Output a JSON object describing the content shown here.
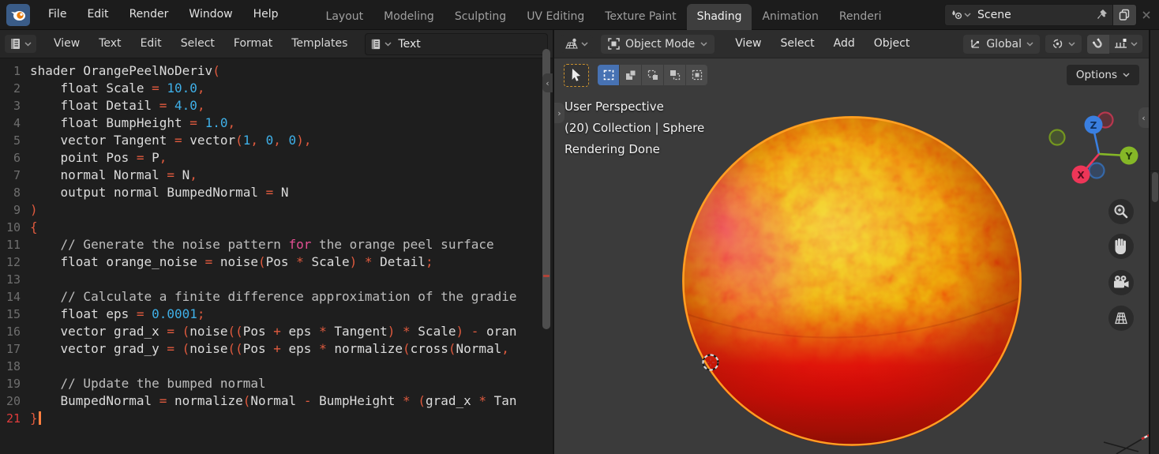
{
  "topbar": {
    "menus": [
      "File",
      "Edit",
      "Render",
      "Window",
      "Help"
    ],
    "workspace_tabs": [
      "Layout",
      "Modeling",
      "Sculpting",
      "UV Editing",
      "Texture Paint",
      "Shading",
      "Animation",
      "Renderi"
    ],
    "active_tab": "Shading",
    "scene": {
      "name": "Scene"
    }
  },
  "text_editor": {
    "menus": [
      "View",
      "Text",
      "Edit",
      "Select",
      "Format",
      "Templates"
    ],
    "datablock_name": "Text",
    "code": {
      "current_line": 21,
      "lines": [
        {
          "num": 1,
          "tokens": [
            [
              "plain",
              "shader OrangePeelNoDeriv"
            ],
            [
              "punct",
              "("
            ]
          ]
        },
        {
          "num": 2,
          "tokens": [
            [
              "plain",
              "    float Scale "
            ],
            [
              "punct",
              "= "
            ],
            [
              "num",
              "10.0"
            ],
            [
              "punct",
              ","
            ]
          ]
        },
        {
          "num": 3,
          "tokens": [
            [
              "plain",
              "    float Detail "
            ],
            [
              "punct",
              "= "
            ],
            [
              "num",
              "4.0"
            ],
            [
              "punct",
              ","
            ]
          ]
        },
        {
          "num": 4,
          "tokens": [
            [
              "plain",
              "    float BumpHeight "
            ],
            [
              "punct",
              "= "
            ],
            [
              "num",
              "1.0"
            ],
            [
              "punct",
              ","
            ]
          ]
        },
        {
          "num": 5,
          "tokens": [
            [
              "plain",
              "    vector Tangent "
            ],
            [
              "punct",
              "= "
            ],
            [
              "plain",
              "vector"
            ],
            [
              "punct",
              "("
            ],
            [
              "num",
              "1"
            ],
            [
              "punct",
              ", "
            ],
            [
              "num",
              "0"
            ],
            [
              "punct",
              ", "
            ],
            [
              "num",
              "0"
            ],
            [
              "punct",
              "),"
            ]
          ]
        },
        {
          "num": 6,
          "tokens": [
            [
              "plain",
              "    point Pos "
            ],
            [
              "punct",
              "= "
            ],
            [
              "plain",
              "P"
            ],
            [
              "punct",
              ","
            ]
          ]
        },
        {
          "num": 7,
          "tokens": [
            [
              "plain",
              "    normal Normal "
            ],
            [
              "punct",
              "= "
            ],
            [
              "plain",
              "N"
            ],
            [
              "punct",
              ","
            ]
          ]
        },
        {
          "num": 8,
          "tokens": [
            [
              "plain",
              "    output normal BumpedNormal "
            ],
            [
              "punct",
              "= "
            ],
            [
              "plain",
              "N"
            ]
          ]
        },
        {
          "num": 9,
          "tokens": [
            [
              "punct",
              ")"
            ]
          ]
        },
        {
          "num": 10,
          "tokens": [
            [
              "punct",
              "{"
            ]
          ]
        },
        {
          "num": 11,
          "tokens": [
            [
              "comment",
              "    // Generate the noise pattern "
            ],
            [
              "keyword",
              "for"
            ],
            [
              "comment",
              " the orange peel surface"
            ]
          ]
        },
        {
          "num": 12,
          "tokens": [
            [
              "plain",
              "    float orange_noise "
            ],
            [
              "punct",
              "= "
            ],
            [
              "plain",
              "noise"
            ],
            [
              "punct",
              "("
            ],
            [
              "plain",
              "Pos "
            ],
            [
              "punct",
              "* "
            ],
            [
              "plain",
              "Scale"
            ],
            [
              "punct",
              ") * "
            ],
            [
              "plain",
              "Detail"
            ],
            [
              "punct",
              ";"
            ]
          ]
        },
        {
          "num": 13,
          "tokens": []
        },
        {
          "num": 14,
          "tokens": [
            [
              "comment",
              "    // Calculate a finite difference approximation of the gradie"
            ]
          ]
        },
        {
          "num": 15,
          "tokens": [
            [
              "plain",
              "    float eps "
            ],
            [
              "punct",
              "= "
            ],
            [
              "num",
              "0.0001"
            ],
            [
              "punct",
              ";"
            ]
          ]
        },
        {
          "num": 16,
          "tokens": [
            [
              "plain",
              "    vector grad_x "
            ],
            [
              "punct",
              "= ("
            ],
            [
              "plain",
              "noise"
            ],
            [
              "punct",
              "(("
            ],
            [
              "plain",
              "Pos "
            ],
            [
              "punct",
              "+ "
            ],
            [
              "plain",
              "eps "
            ],
            [
              "punct",
              "* "
            ],
            [
              "plain",
              "Tangent"
            ],
            [
              "punct",
              ") * "
            ],
            [
              "plain",
              "Scale"
            ],
            [
              "punct",
              ") - "
            ],
            [
              "plain",
              "oran"
            ]
          ]
        },
        {
          "num": 17,
          "tokens": [
            [
              "plain",
              "    vector grad_y "
            ],
            [
              "punct",
              "= ("
            ],
            [
              "plain",
              "noise"
            ],
            [
              "punct",
              "(("
            ],
            [
              "plain",
              "Pos "
            ],
            [
              "punct",
              "+ "
            ],
            [
              "plain",
              "eps "
            ],
            [
              "punct",
              "* "
            ],
            [
              "plain",
              "normalize"
            ],
            [
              "punct",
              "("
            ],
            [
              "plain",
              "cross"
            ],
            [
              "punct",
              "("
            ],
            [
              "plain",
              "Normal"
            ],
            [
              "punct",
              ","
            ]
          ]
        },
        {
          "num": 18,
          "tokens": []
        },
        {
          "num": 19,
          "tokens": [
            [
              "comment",
              "    // Update the bumped normal"
            ]
          ]
        },
        {
          "num": 20,
          "tokens": [
            [
              "plain",
              "    BumpedNormal "
            ],
            [
              "punct",
              "= "
            ],
            [
              "plain",
              "normalize"
            ],
            [
              "punct",
              "("
            ],
            [
              "plain",
              "Normal "
            ],
            [
              "punct",
              "- "
            ],
            [
              "plain",
              "BumpHeight "
            ],
            [
              "punct",
              "* ("
            ],
            [
              "plain",
              "grad_x "
            ],
            [
              "punct",
              "* "
            ],
            [
              "plain",
              "Tan"
            ]
          ]
        },
        {
          "num": 21,
          "tokens": [
            [
              "punct",
              "}"
            ]
          ]
        }
      ]
    }
  },
  "viewport": {
    "mode": "Object Mode",
    "menus": [
      "View",
      "Select",
      "Add",
      "Object"
    ],
    "orientation": "Global",
    "options_label": "Options",
    "overlay_lines": [
      "User Perspective",
      "(20) Collection | Sphere",
      "Rendering Done"
    ],
    "gizmo_axes": {
      "x": "X",
      "y": "Y",
      "z": "Z"
    }
  },
  "colors": {
    "accent-blue": "#4772b3",
    "syntax-plain": "#dcdcdc",
    "syntax-punct": "#e05a3e",
    "syntax-num": "#3fb0e8",
    "syntax-keyword": "#e44f93",
    "syntax-comment": "#bdbdbd",
    "line-number": "#6e6e6e",
    "line-number-active": "#e23c3c",
    "cursor-orange": "#ff7f3f",
    "gizmo-x": "#ee3658",
    "gizmo-y": "#85b727",
    "gizmo-z": "#3a7fe0",
    "selection-outline": "#ffa023",
    "viewport-bg": "#3b3b3b"
  }
}
